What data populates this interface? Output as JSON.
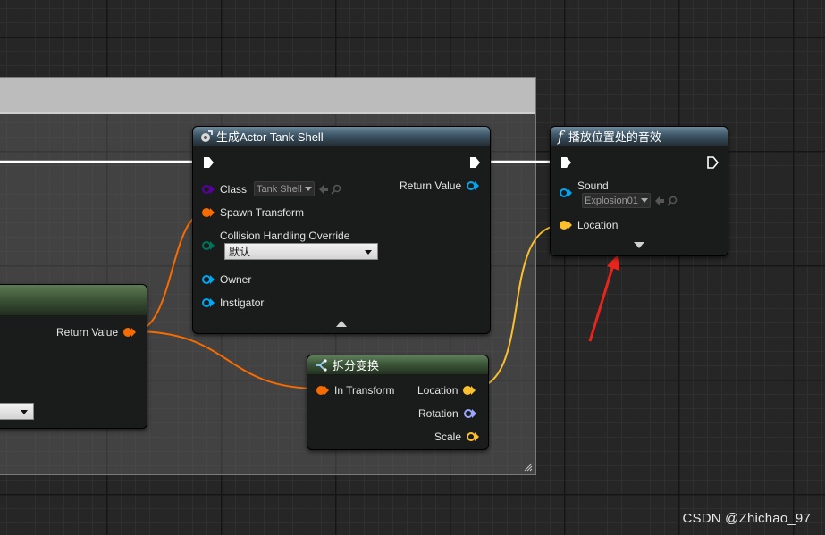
{
  "colors": {
    "exec": "#ffffff",
    "class_pin": "#5a00a3",
    "struct_pin": "#f76b00",
    "object_pin": "#00a8f4",
    "location_pin": "#fbc02d",
    "rotation_pin": "#9aa6ff",
    "enum_pin": "#00735a",
    "arrow_annotation": "#e8251c"
  },
  "spawn_node": {
    "title": "生成Actor Tank Shell",
    "icon": "spawn-actor-icon",
    "class_label": "Class",
    "class_value": "Tank Shell",
    "return_label": "Return Value",
    "spawn_transform_label": "Spawn Transform",
    "collision_label": "Collision Handling Override",
    "collision_value": "默认",
    "owner_label": "Owner",
    "instigator_label": "Instigator"
  },
  "sound_node": {
    "title": "播放位置处的音效",
    "icon": "function-icon",
    "sound_label": "Sound",
    "sound_value": "Explosion01",
    "location_label": "Location"
  },
  "break_node": {
    "title": "拆分变换",
    "icon": "break-struct-icon",
    "in_label": "In Transform",
    "location_label": "Location",
    "rotation_label": "Rotation",
    "scale_label": "Scale"
  },
  "left_node": {
    "return_label": "Return Value"
  },
  "watermark": "CSDN @Zhichao_97"
}
